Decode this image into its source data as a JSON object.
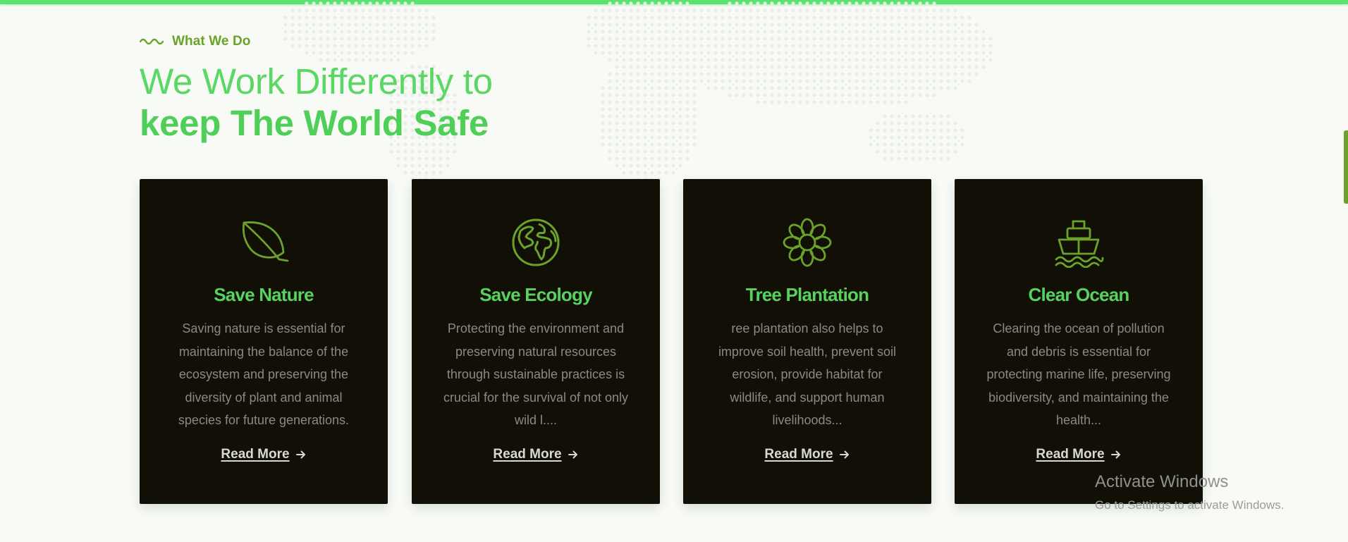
{
  "section": {
    "eyebrow": "What We Do",
    "heading_line1": "We Work Differently to",
    "heading_line2": "keep The World Safe"
  },
  "cards": [
    {
      "icon": "leaf-icon",
      "title": "Save Nature",
      "description": "Saving nature is essential for maintaining the balance of the ecosystem and preserving the diversity of plant and animal species for future generations.",
      "link_label": "Read More"
    },
    {
      "icon": "globe-icon",
      "title": "Save Ecology",
      "description": "Protecting the environment and preserving natural resources through sustainable practices is crucial for the survival of not only wild l....",
      "link_label": "Read More"
    },
    {
      "icon": "flower-icon",
      "title": "Tree Plantation",
      "description": "ree plantation also helps to improve soil health, prevent soil erosion, provide habitat for wildlife, and support human livelihoods...",
      "link_label": "Read More"
    },
    {
      "icon": "ship-icon",
      "title": "Clear Ocean",
      "description": "Clearing the ocean of pollution and debris is essential for protecting marine life, preserving biodiversity, and maintaining the health...",
      "link_label": "Read More"
    }
  ],
  "watermark": {
    "title": "Activate Windows",
    "subtitle": "Go to Settings to activate Windows."
  },
  "colors": {
    "accent_green": "#58d25f",
    "eyebrow_green": "#6aa22b",
    "card_bg": "#120f06",
    "page_bg": "#f7faf5"
  }
}
